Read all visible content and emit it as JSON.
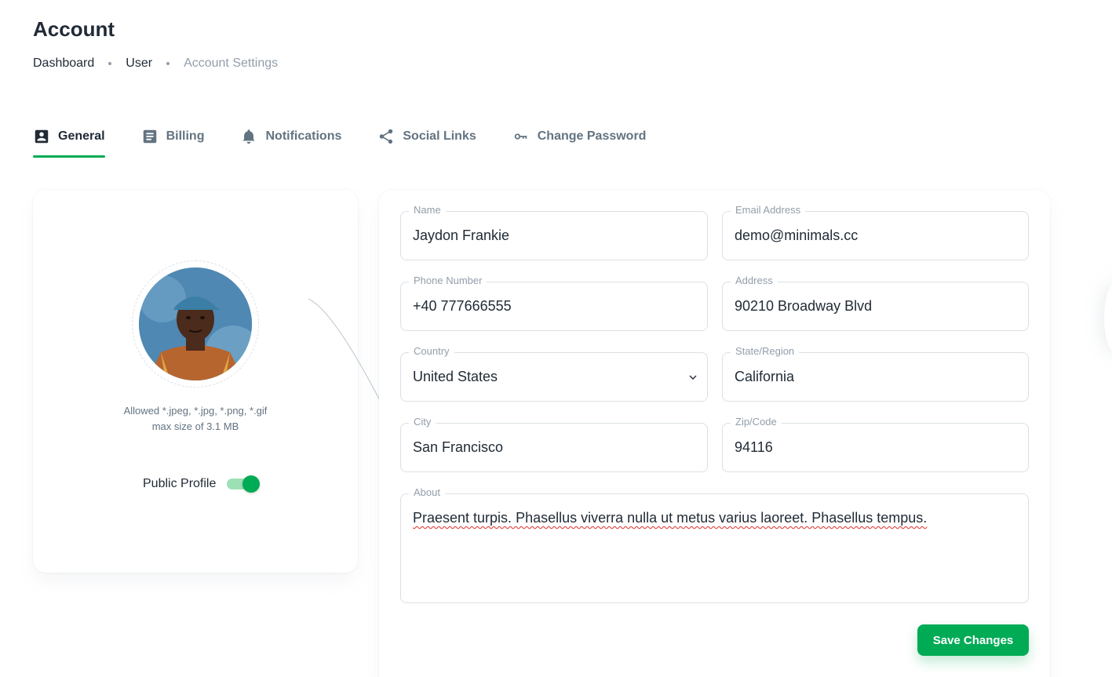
{
  "page": {
    "title": "Account",
    "breadcrumb": [
      "Dashboard",
      "User",
      "Account Settings"
    ]
  },
  "tabs": [
    {
      "label": "General",
      "icon": "account-box-icon",
      "active": true
    },
    {
      "label": "Billing",
      "icon": "receipt-icon",
      "active": false
    },
    {
      "label": "Notifications",
      "icon": "bell-icon",
      "active": false
    },
    {
      "label": "Social Links",
      "icon": "share-icon",
      "active": false
    },
    {
      "label": "Change Password",
      "icon": "key-icon",
      "active": false
    }
  ],
  "profile": {
    "upload_note_line1": "Allowed *.jpeg, *.jpg, *.png, *.gif",
    "upload_note_line2": "max size of 3.1 MB",
    "public_profile_label": "Public Profile",
    "public_profile_enabled": true
  },
  "form": {
    "name": {
      "label": "Name",
      "value": "Jaydon Frankie"
    },
    "email": {
      "label": "Email Address",
      "value": "demo@minimals.cc"
    },
    "phone": {
      "label": "Phone Number",
      "value": "+40 777666555"
    },
    "address": {
      "label": "Address",
      "value": "90210 Broadway Blvd"
    },
    "country": {
      "label": "Country",
      "value": "United States"
    },
    "state": {
      "label": "State/Region",
      "value": "California"
    },
    "city": {
      "label": "City",
      "value": "San Francisco"
    },
    "zip": {
      "label": "Zip/Code",
      "value": "94116"
    },
    "about": {
      "label": "About",
      "value": "Praesent turpis. Phasellus viverra nulla ut metus varius laoreet. Phasellus tempus."
    },
    "save_label": "Save Changes"
  },
  "colors": {
    "primary": "#00ab55",
    "text_primary": "#212b36",
    "text_secondary": "#637381",
    "text_disabled": "#919eab"
  }
}
